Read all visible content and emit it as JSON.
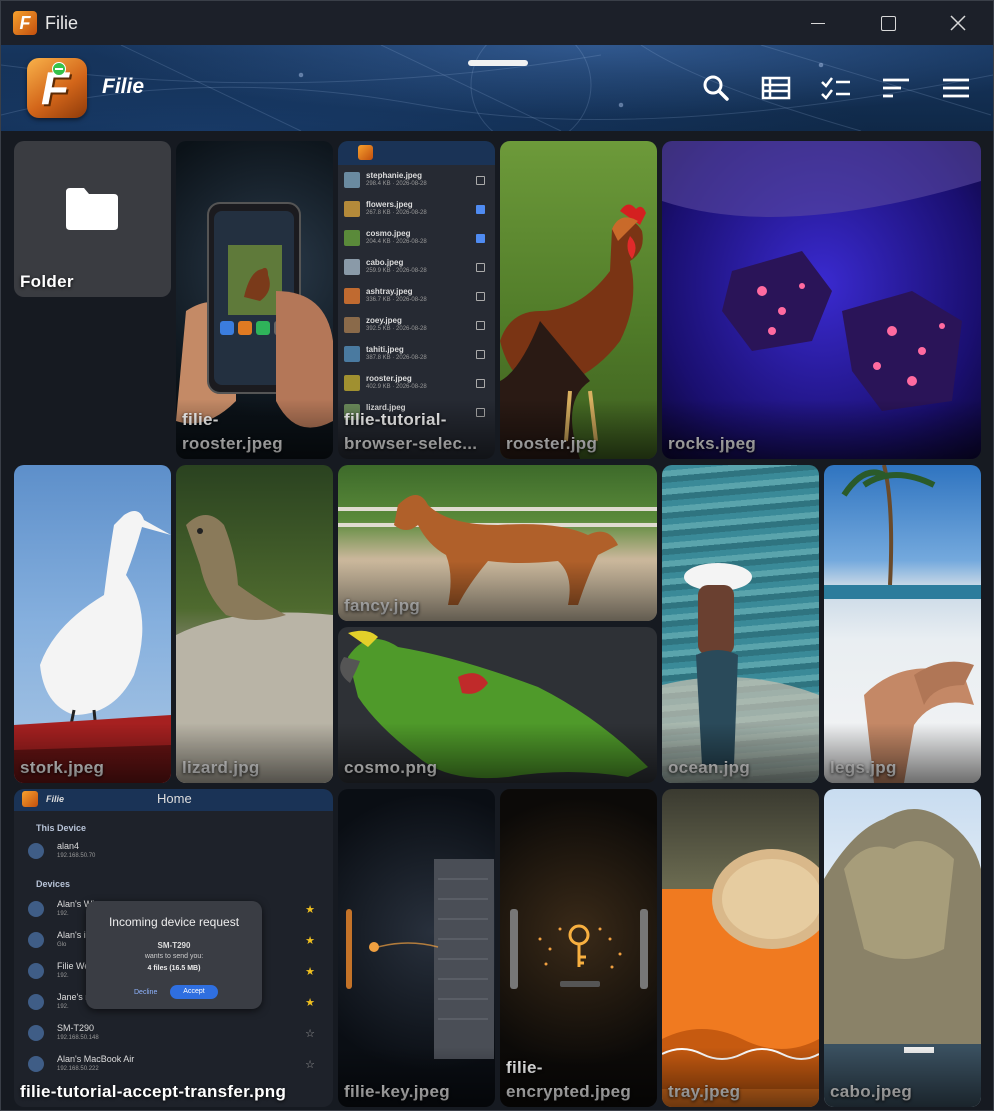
{
  "window": {
    "title": "Filie",
    "minimize_icon": "minimize-icon",
    "maximize_icon": "maximize-icon",
    "close_icon": "close-icon"
  },
  "appbar": {
    "name": "Filie",
    "actions": [
      "search-icon",
      "list-view-icon",
      "select-icon",
      "sort-icon",
      "menu-icon"
    ]
  },
  "items": {
    "folder": "Folder",
    "filie_rooster": "filie-\nrooster.jpeg",
    "tutorial_browser": "filie-tutorial-\nbrowser-selec...",
    "rooster": "rooster.jpg",
    "rocks": "rocks.jpeg",
    "stork": "stork.jpeg",
    "lizard": "lizard.jpg",
    "fancy": "fancy.jpg",
    "cosmo": "cosmo.png",
    "ocean": "ocean.jpg",
    "legs": "legs.jpg",
    "tutorial_accept": "filie-tutorial-accept-transfer.png",
    "key": "filie-key.jpeg",
    "encrypted": "filie-\nencrypted.jpeg",
    "tray": "tray.jpeg",
    "cabo": "cabo.jpeg"
  },
  "browser_shot": {
    "rows": [
      {
        "name": "stephanie.jpeg",
        "meta": "298.4 KB · 2026-08-28",
        "checked": false
      },
      {
        "name": "flowers.jpeg",
        "meta": "267.8 KB · 2026-08-28",
        "checked": true
      },
      {
        "name": "cosmo.jpeg",
        "meta": "204.4 KB · 2026-08-28",
        "checked": true
      },
      {
        "name": "cabo.jpeg",
        "meta": "259.9 KB · 2026-08-28",
        "checked": false
      },
      {
        "name": "ashtray.jpeg",
        "meta": "336.7 KB · 2026-08-28",
        "checked": false
      },
      {
        "name": "zoey.jpeg",
        "meta": "392.5 KB · 2026-08-28",
        "checked": false
      },
      {
        "name": "tahiti.jpeg",
        "meta": "387.8 KB · 2026-08-28",
        "checked": false
      },
      {
        "name": "rooster.jpeg",
        "meta": "402.9 KB · 2026-08-28",
        "checked": false
      },
      {
        "name": "lizard.jpeg",
        "meta": "",
        "checked": false
      }
    ]
  },
  "transfer_shot": {
    "app": "Filie",
    "header": "Home",
    "this_device": "This Device",
    "local_name": "alan4",
    "local_ip": "192.168.50.70",
    "devices_label": "Devices",
    "devices": [
      {
        "name": "Alan's Wi",
        "ip": "192."
      },
      {
        "name": "Alan's iPh",
        "ip": "Glo"
      },
      {
        "name": "Filie Wel",
        "ip": "192."
      },
      {
        "name": "Jane's m",
        "ip": "192."
      },
      {
        "name": "SM-T290",
        "ip": "192.168.50.148"
      },
      {
        "name": "Alan's MacBook Air",
        "ip": "192.168.50.222"
      }
    ],
    "dialog_title": "Incoming device request",
    "dialog_device": "SM-T290",
    "dialog_text": "wants to send you:",
    "dialog_files": "4 files (16.5 MB)",
    "decline": "Decline",
    "accept": "Accept"
  }
}
